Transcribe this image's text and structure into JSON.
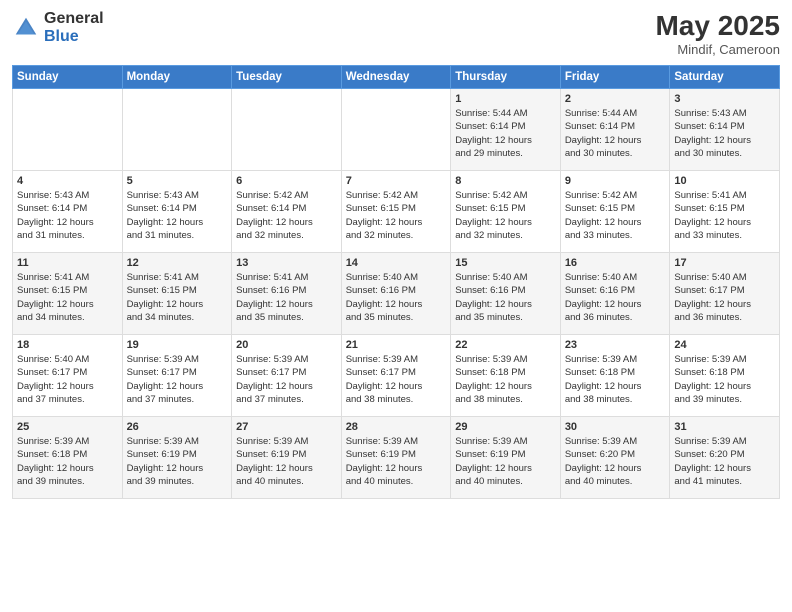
{
  "header": {
    "logo_general": "General",
    "logo_blue": "Blue",
    "title": "May 2025",
    "location": "Mindif, Cameroon"
  },
  "calendar": {
    "days_of_week": [
      "Sunday",
      "Monday",
      "Tuesday",
      "Wednesday",
      "Thursday",
      "Friday",
      "Saturday"
    ],
    "weeks": [
      [
        {
          "day": "",
          "text": ""
        },
        {
          "day": "",
          "text": ""
        },
        {
          "day": "",
          "text": ""
        },
        {
          "day": "",
          "text": ""
        },
        {
          "day": "1",
          "text": "Sunrise: 5:44 AM\nSunset: 6:14 PM\nDaylight: 12 hours\nand 29 minutes."
        },
        {
          "day": "2",
          "text": "Sunrise: 5:44 AM\nSunset: 6:14 PM\nDaylight: 12 hours\nand 30 minutes."
        },
        {
          "day": "3",
          "text": "Sunrise: 5:43 AM\nSunset: 6:14 PM\nDaylight: 12 hours\nand 30 minutes."
        }
      ],
      [
        {
          "day": "4",
          "text": "Sunrise: 5:43 AM\nSunset: 6:14 PM\nDaylight: 12 hours\nand 31 minutes."
        },
        {
          "day": "5",
          "text": "Sunrise: 5:43 AM\nSunset: 6:14 PM\nDaylight: 12 hours\nand 31 minutes."
        },
        {
          "day": "6",
          "text": "Sunrise: 5:42 AM\nSunset: 6:14 PM\nDaylight: 12 hours\nand 32 minutes."
        },
        {
          "day": "7",
          "text": "Sunrise: 5:42 AM\nSunset: 6:15 PM\nDaylight: 12 hours\nand 32 minutes."
        },
        {
          "day": "8",
          "text": "Sunrise: 5:42 AM\nSunset: 6:15 PM\nDaylight: 12 hours\nand 32 minutes."
        },
        {
          "day": "9",
          "text": "Sunrise: 5:42 AM\nSunset: 6:15 PM\nDaylight: 12 hours\nand 33 minutes."
        },
        {
          "day": "10",
          "text": "Sunrise: 5:41 AM\nSunset: 6:15 PM\nDaylight: 12 hours\nand 33 minutes."
        }
      ],
      [
        {
          "day": "11",
          "text": "Sunrise: 5:41 AM\nSunset: 6:15 PM\nDaylight: 12 hours\nand 34 minutes."
        },
        {
          "day": "12",
          "text": "Sunrise: 5:41 AM\nSunset: 6:15 PM\nDaylight: 12 hours\nand 34 minutes."
        },
        {
          "day": "13",
          "text": "Sunrise: 5:41 AM\nSunset: 6:16 PM\nDaylight: 12 hours\nand 35 minutes."
        },
        {
          "day": "14",
          "text": "Sunrise: 5:40 AM\nSunset: 6:16 PM\nDaylight: 12 hours\nand 35 minutes."
        },
        {
          "day": "15",
          "text": "Sunrise: 5:40 AM\nSunset: 6:16 PM\nDaylight: 12 hours\nand 35 minutes."
        },
        {
          "day": "16",
          "text": "Sunrise: 5:40 AM\nSunset: 6:16 PM\nDaylight: 12 hours\nand 36 minutes."
        },
        {
          "day": "17",
          "text": "Sunrise: 5:40 AM\nSunset: 6:17 PM\nDaylight: 12 hours\nand 36 minutes."
        }
      ],
      [
        {
          "day": "18",
          "text": "Sunrise: 5:40 AM\nSunset: 6:17 PM\nDaylight: 12 hours\nand 37 minutes."
        },
        {
          "day": "19",
          "text": "Sunrise: 5:39 AM\nSunset: 6:17 PM\nDaylight: 12 hours\nand 37 minutes."
        },
        {
          "day": "20",
          "text": "Sunrise: 5:39 AM\nSunset: 6:17 PM\nDaylight: 12 hours\nand 37 minutes."
        },
        {
          "day": "21",
          "text": "Sunrise: 5:39 AM\nSunset: 6:17 PM\nDaylight: 12 hours\nand 38 minutes."
        },
        {
          "day": "22",
          "text": "Sunrise: 5:39 AM\nSunset: 6:18 PM\nDaylight: 12 hours\nand 38 minutes."
        },
        {
          "day": "23",
          "text": "Sunrise: 5:39 AM\nSunset: 6:18 PM\nDaylight: 12 hours\nand 38 minutes."
        },
        {
          "day": "24",
          "text": "Sunrise: 5:39 AM\nSunset: 6:18 PM\nDaylight: 12 hours\nand 39 minutes."
        }
      ],
      [
        {
          "day": "25",
          "text": "Sunrise: 5:39 AM\nSunset: 6:18 PM\nDaylight: 12 hours\nand 39 minutes."
        },
        {
          "day": "26",
          "text": "Sunrise: 5:39 AM\nSunset: 6:19 PM\nDaylight: 12 hours\nand 39 minutes."
        },
        {
          "day": "27",
          "text": "Sunrise: 5:39 AM\nSunset: 6:19 PM\nDaylight: 12 hours\nand 40 minutes."
        },
        {
          "day": "28",
          "text": "Sunrise: 5:39 AM\nSunset: 6:19 PM\nDaylight: 12 hours\nand 40 minutes."
        },
        {
          "day": "29",
          "text": "Sunrise: 5:39 AM\nSunset: 6:19 PM\nDaylight: 12 hours\nand 40 minutes."
        },
        {
          "day": "30",
          "text": "Sunrise: 5:39 AM\nSunset: 6:20 PM\nDaylight: 12 hours\nand 40 minutes."
        },
        {
          "day": "31",
          "text": "Sunrise: 5:39 AM\nSunset: 6:20 PM\nDaylight: 12 hours\nand 41 minutes."
        }
      ]
    ]
  }
}
